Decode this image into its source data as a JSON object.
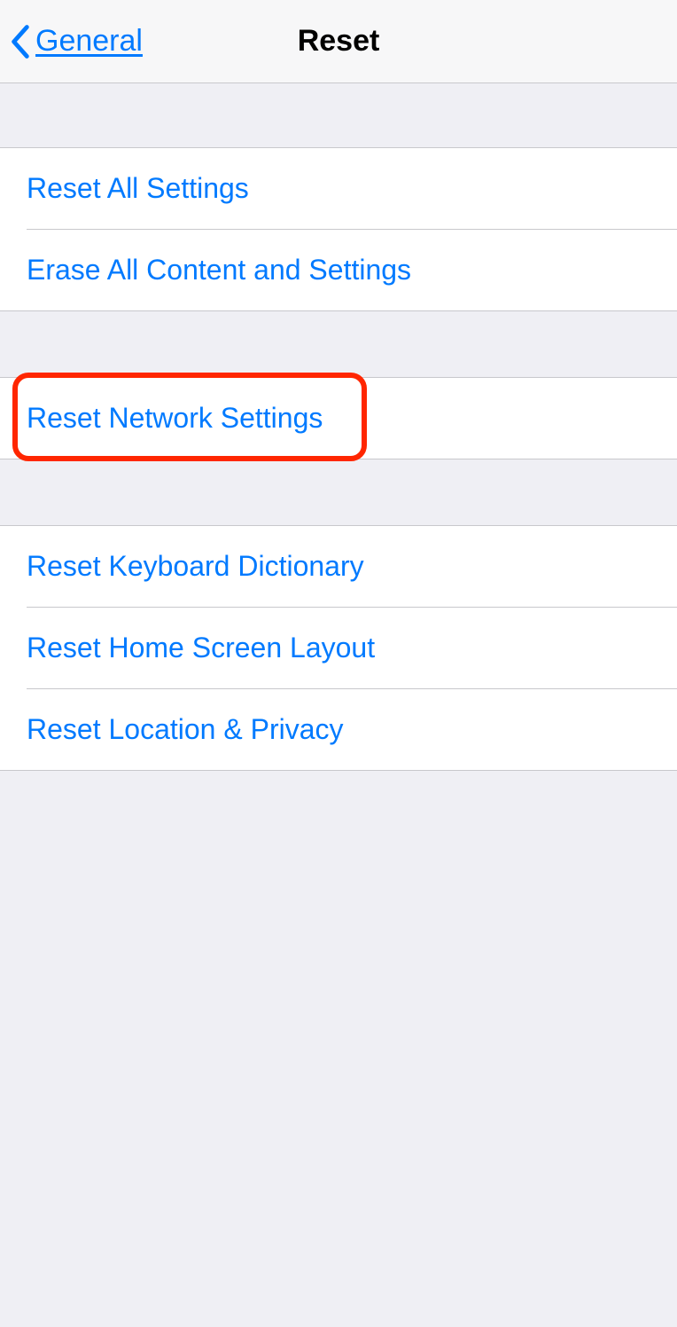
{
  "nav": {
    "back_label": "General",
    "title": "Reset"
  },
  "sections": [
    {
      "rows": [
        {
          "label": "Reset All Settings"
        },
        {
          "label": "Erase All Content and Settings"
        }
      ]
    },
    {
      "rows": [
        {
          "label": "Reset Network Settings"
        }
      ]
    },
    {
      "rows": [
        {
          "label": "Reset Keyboard Dictionary"
        },
        {
          "label": "Reset Home Screen Layout"
        },
        {
          "label": "Reset Location & Privacy"
        }
      ]
    }
  ]
}
